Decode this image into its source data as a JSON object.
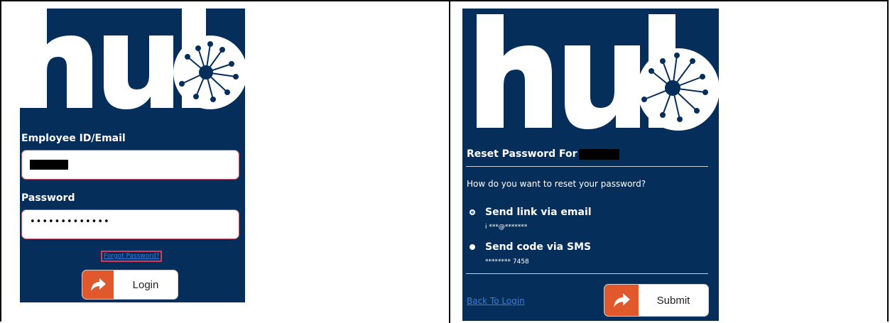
{
  "login": {
    "logo_text": "hub",
    "employee_label": "Employee ID/Email",
    "password_label": "Password",
    "password_value": "•••••••••••••",
    "forgot_link": "Forgot Password?",
    "login_button": "Login"
  },
  "reset": {
    "logo_text": "hub",
    "title": "Reset Password For :",
    "question": "How do you want to reset your password?",
    "options": [
      {
        "label": "Send link via email",
        "detail": "i ***@*******",
        "selected": true
      },
      {
        "label": "Send code via SMS",
        "detail": "******** 7458",
        "selected": false
      }
    ],
    "back_link": "Back To Login",
    "submit_button": "Submit"
  },
  "colors": {
    "panel": "#062e5a",
    "accent": "#e0582b",
    "field_border": "#c9556c",
    "link": "#3a7de0"
  },
  "icons": [
    "hub-logo-icon",
    "arrow-share-icon",
    "radio-selected-icon",
    "radio-unselected-icon"
  ]
}
